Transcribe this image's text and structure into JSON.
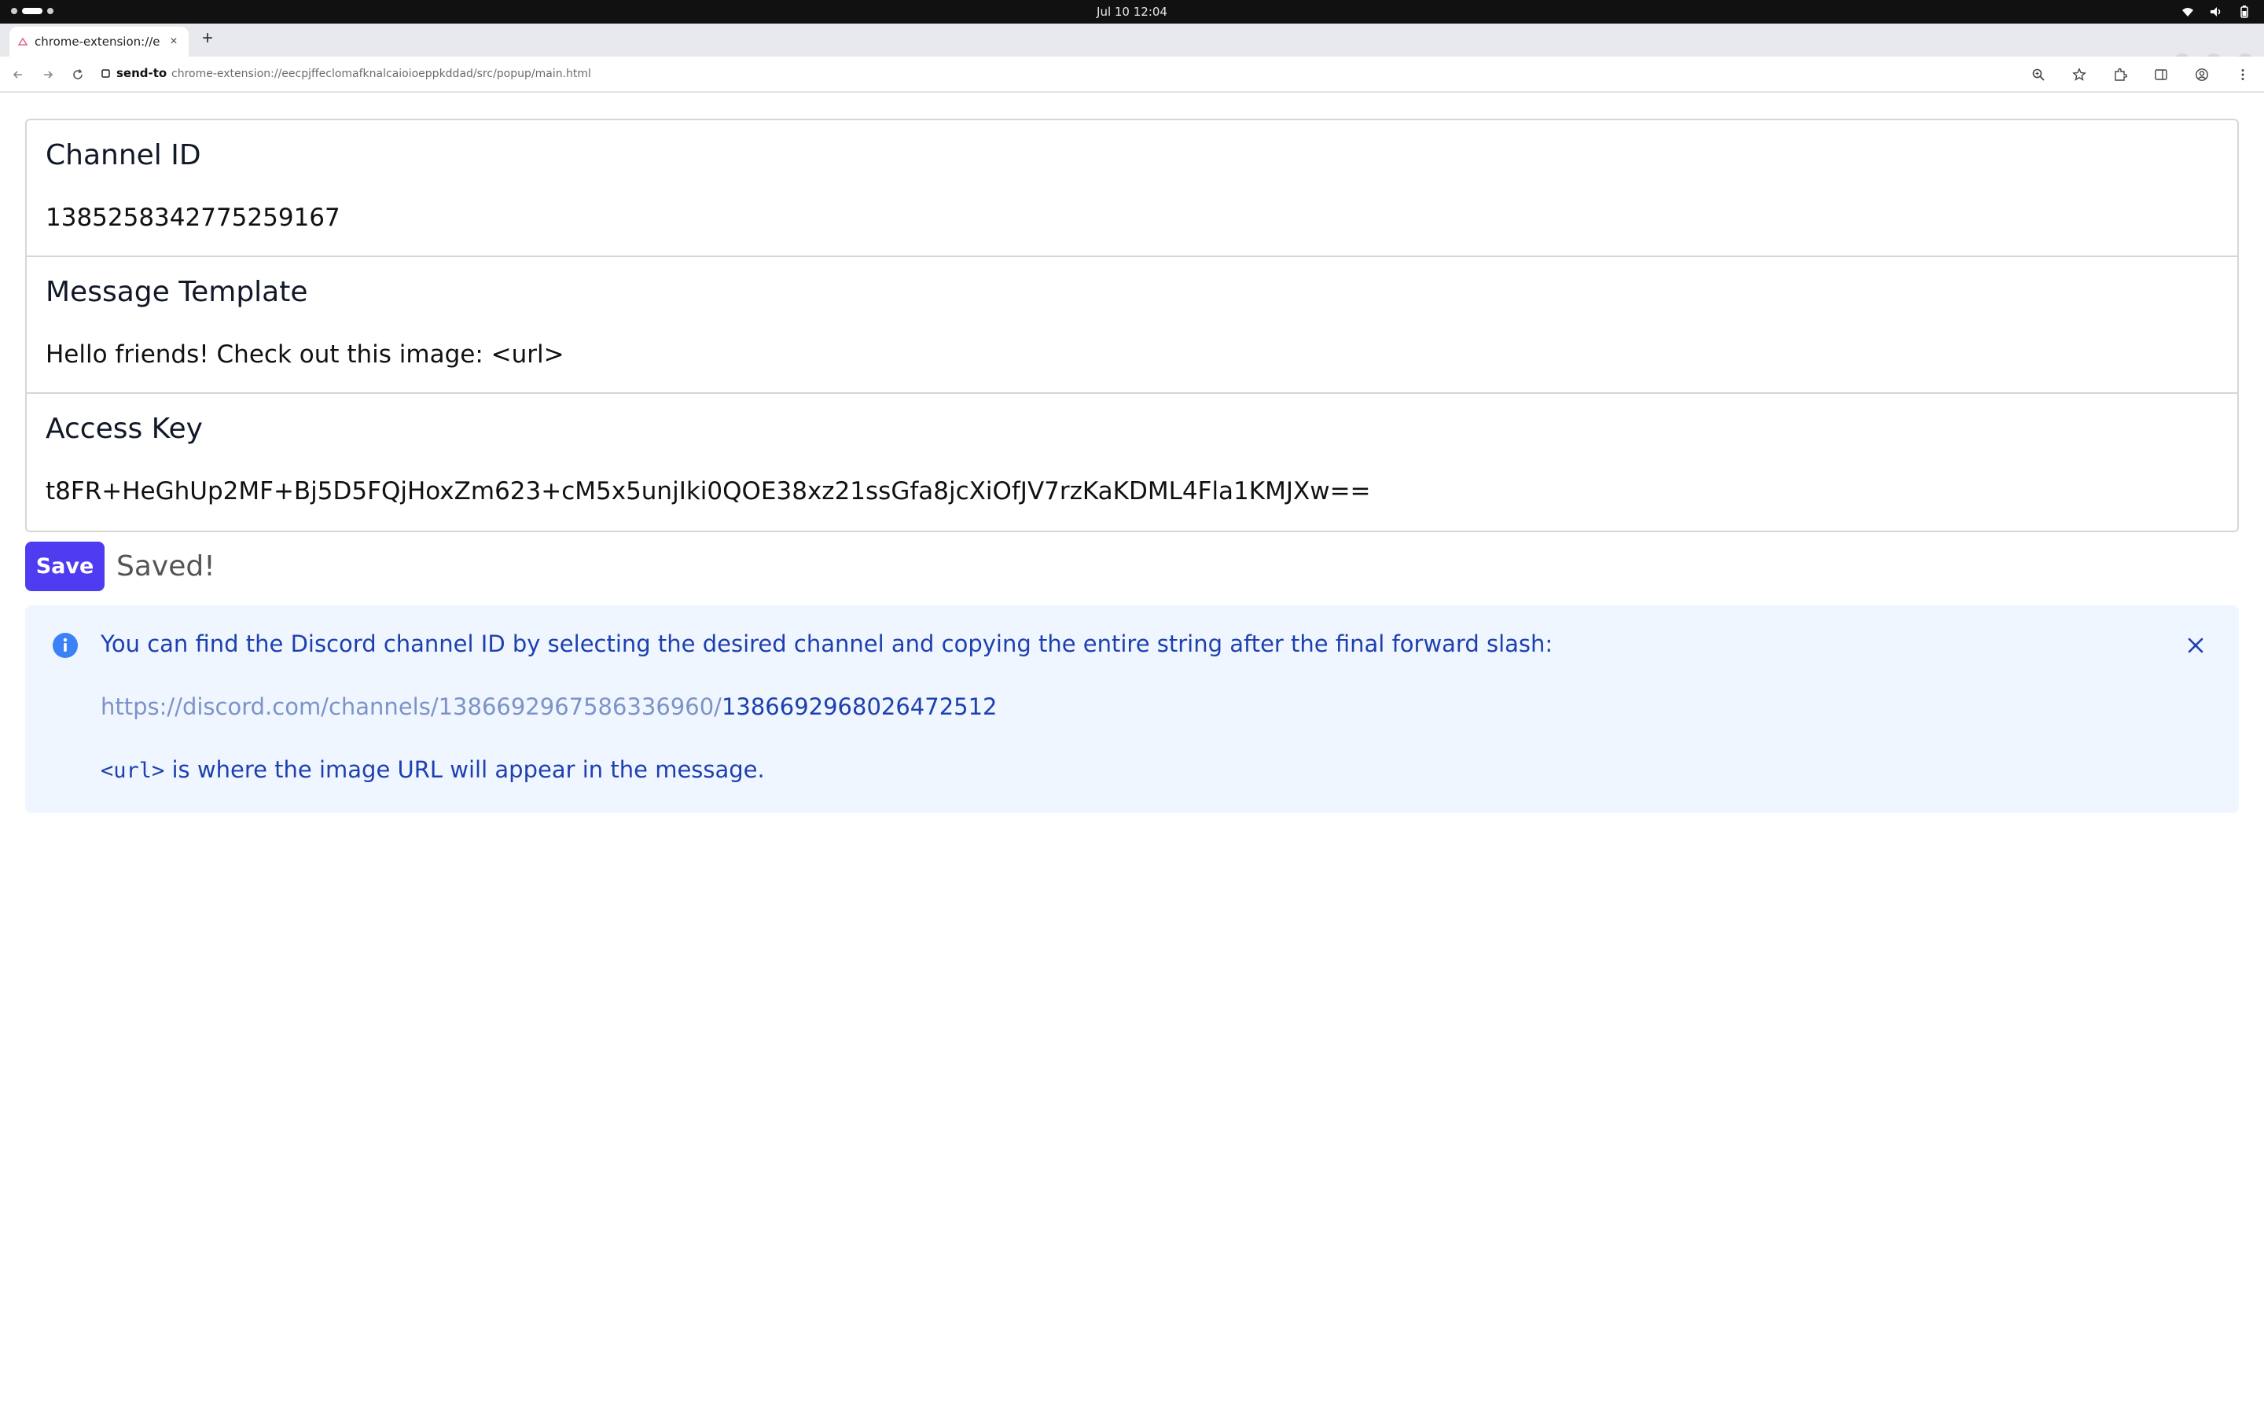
{
  "os": {
    "clock": "Jul 10  12:04"
  },
  "browser": {
    "tab_title": "chrome-extension://eec",
    "tab_close": "×",
    "new_tab": "+",
    "site_label": "send-to",
    "url": "chrome-extension://eecpjffeclomafknalcaioioeppkddad/src/popup/main.html"
  },
  "form": {
    "fields": [
      {
        "label": "Channel ID",
        "value": "1385258342775259167"
      },
      {
        "label": "Message Template",
        "value": "Hello friends! Check out this image: <url>"
      },
      {
        "label": "Access Key",
        "value": "t8FR+HeGhUp2MF+Bj5D5FQjHoxZm623+cM5x5unjIki0QOE38xz21ssGfa8jcXiOfJV7rzKaKDML4Fla1KMJXw=="
      }
    ],
    "save_label": "Save",
    "status_text": "Saved!"
  },
  "info": {
    "line1": "You can find the Discord channel ID by selecting the desired channel and copying the entire string after the final forward slash:",
    "example_url_base": "https://discord.com/channels/1386692967586336960/",
    "example_url_id": "1386692968026472512",
    "url_token": "<url>",
    "line3_rest": " is where the image URL will appear in the message."
  },
  "colors": {
    "accent": "#4f3cf0",
    "info_bg": "#eff6ff",
    "info_text": "#1e40af"
  }
}
